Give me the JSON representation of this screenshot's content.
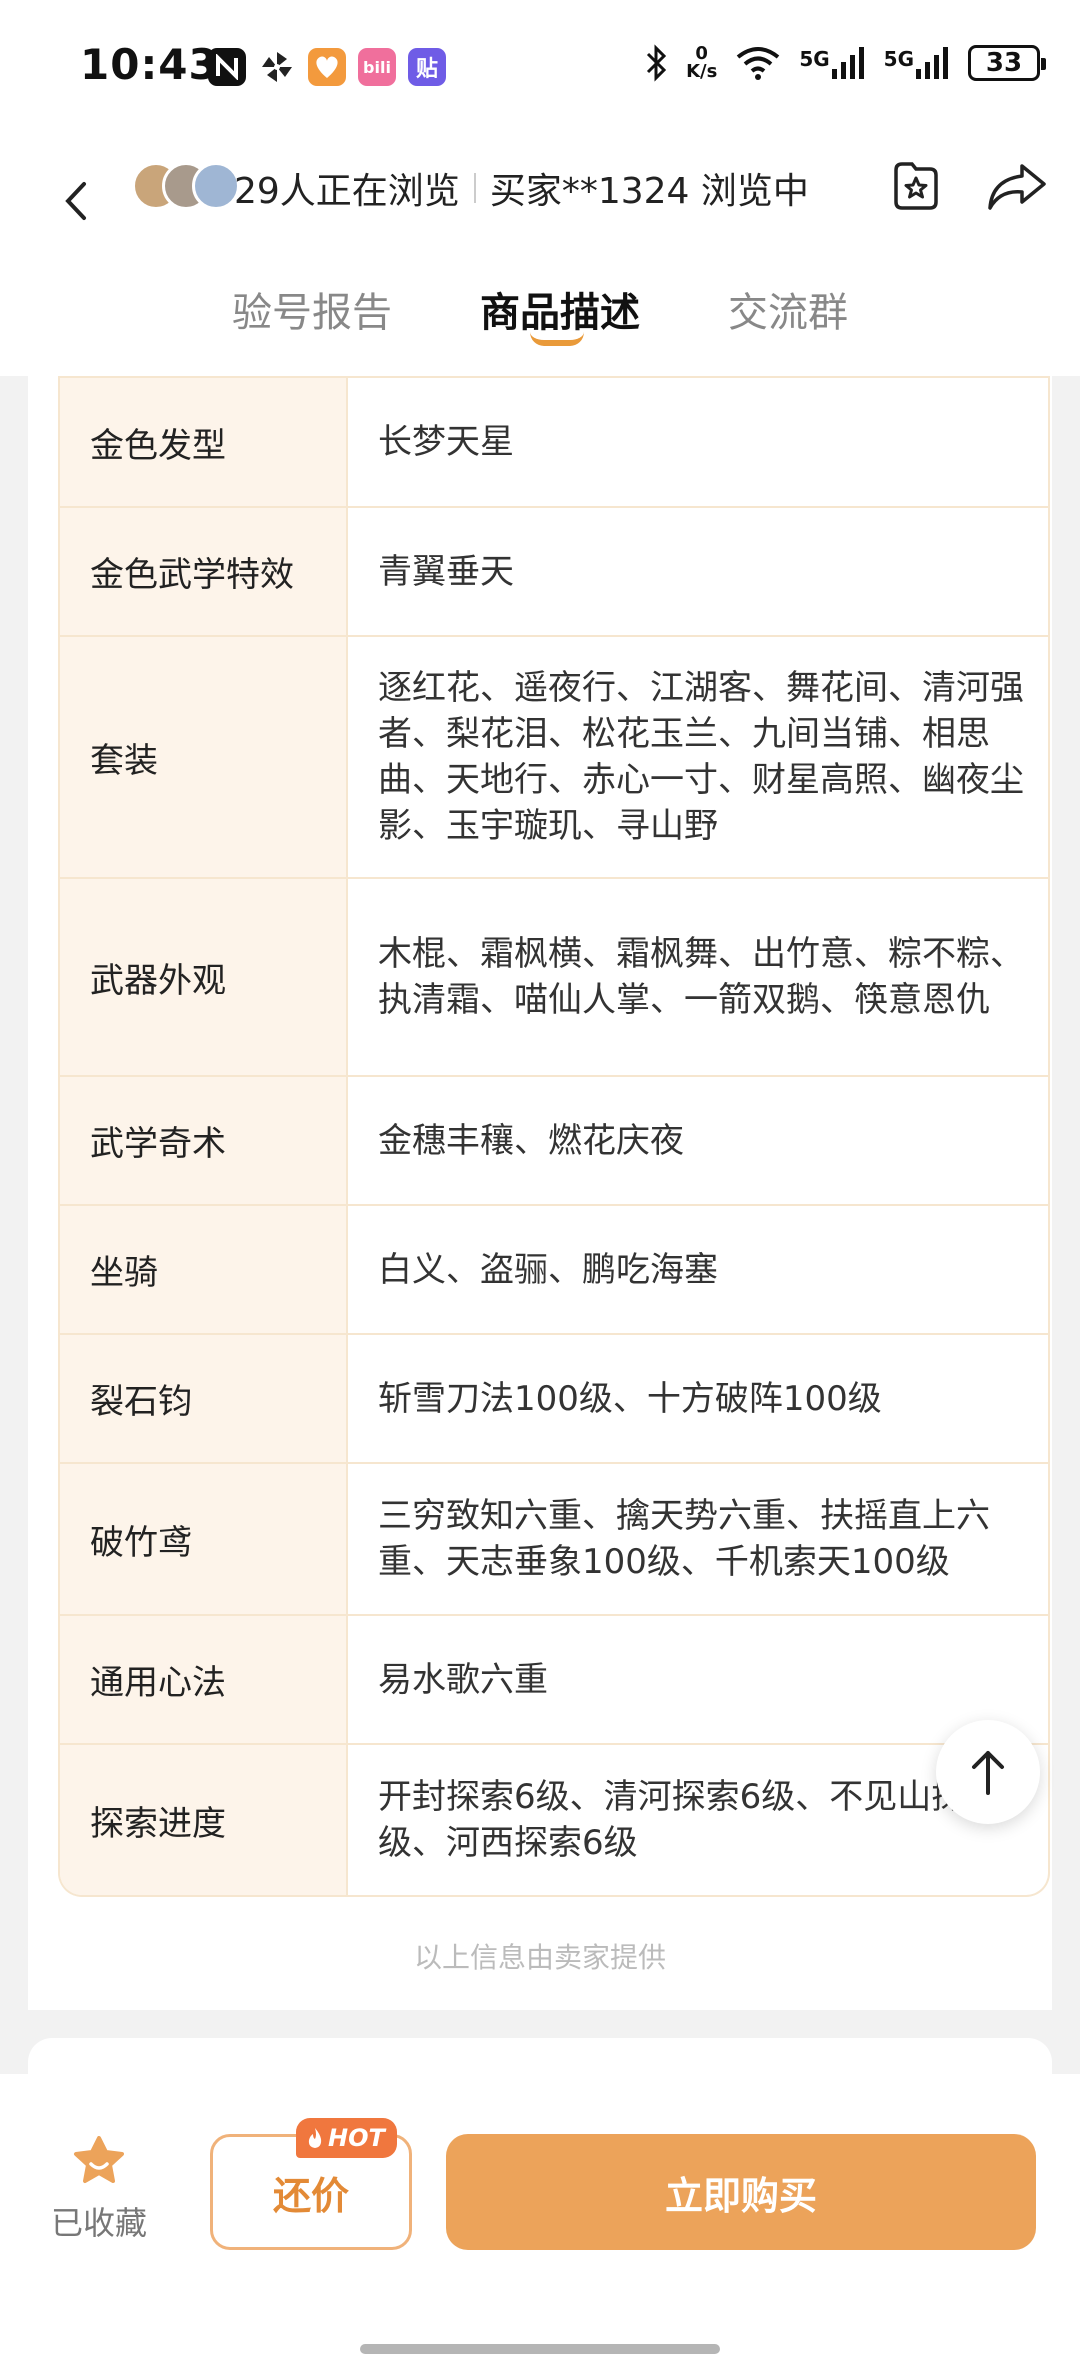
{
  "status_bar": {
    "time": "10:43",
    "net_speed_value": "0",
    "net_speed_unit": "K/s",
    "sim1": "5G",
    "sim2": "5G",
    "battery": "33",
    "app_icons": [
      "nfc-icon",
      "pinwheel-icon",
      "heart-app-icon",
      "bilibili-icon",
      "sticker-app-icon"
    ],
    "bilibili_text": "bili",
    "sticker_text": "贴"
  },
  "header": {
    "browsing_count": "29人正在浏览",
    "buyer_browsing": "买家**1324 浏览中"
  },
  "tabs": [
    {
      "label": "验号报告",
      "active": false
    },
    {
      "label": "商品描述",
      "active": true
    },
    {
      "label": "交流群",
      "active": false
    }
  ],
  "table": [
    {
      "key": "金色发型",
      "value": "长梦天星"
    },
    {
      "key": "金色武学特效",
      "value": "青翼垂天"
    },
    {
      "key": "套装",
      "value": "逐红花、遥夜行、江湖客、舞花间、清河强者、梨花泪、松花玉兰、九间当铺、相思曲、天地行、赤心一寸、财星高照、幽夜尘影、玉宇璇玑、寻山野"
    },
    {
      "key": "武器外观",
      "value": "木棍、霜枫横、霜枫舞、出竹意、粽不粽、执清霜、喵仙人掌、一箭双鹅、筷意恩仇"
    },
    {
      "key": "武学奇术",
      "value": "金穗丰穰、燃花庆夜"
    },
    {
      "key": "坐骑",
      "value": "白义、盗骊、鹏吃海塞"
    },
    {
      "key": "裂石钧",
      "value": "斩雪刀法100级、十方破阵100级"
    },
    {
      "key": "破竹鸢",
      "value": "三穷致知六重、擒天势六重、扶摇直上六重、天志垂象100级、千机索天100级"
    },
    {
      "key": "通用心法",
      "value": "易水歌六重"
    },
    {
      "key": "探索进度",
      "value": "开封探索6级、清河探索6级、不见山探索6级、河西探索6级"
    }
  ],
  "footnote": "以上信息由卖家提供",
  "bottom_bar": {
    "favorite_label": "已收藏",
    "bargain_label": "还价",
    "hot_badge": "HOT",
    "buy_label": "立即购买"
  },
  "colors": {
    "accent": "#eca35a",
    "table_key_bg": "#fdf4ea",
    "table_border": "#f6e6cf",
    "hot_badge": "#f0773e"
  }
}
